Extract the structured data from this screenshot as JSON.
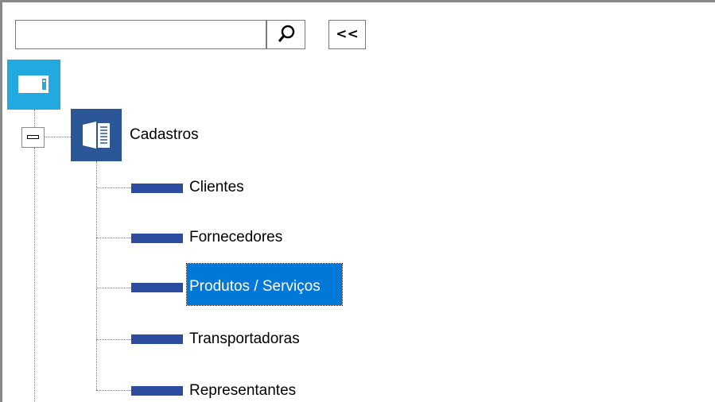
{
  "toolbar": {
    "search_value": "",
    "search_icon": "magnifier-icon",
    "collapse_label": "<<"
  },
  "tree": {
    "root_icon": "window-icon",
    "root_color": "#22a9e0",
    "group": {
      "label": "Cadastros",
      "expanded": true,
      "icon": "book-icon",
      "icon_color": "#2b5797"
    },
    "items": [
      {
        "label": "Clientes"
      },
      {
        "label": "Fornecedores"
      },
      {
        "label": "Produtos / Serviços",
        "selected": true
      },
      {
        "label": "Transportadoras"
      },
      {
        "label": "Representantes"
      }
    ],
    "item_icon_color": "#2b4d9f",
    "selection_color": "#0078d7"
  }
}
